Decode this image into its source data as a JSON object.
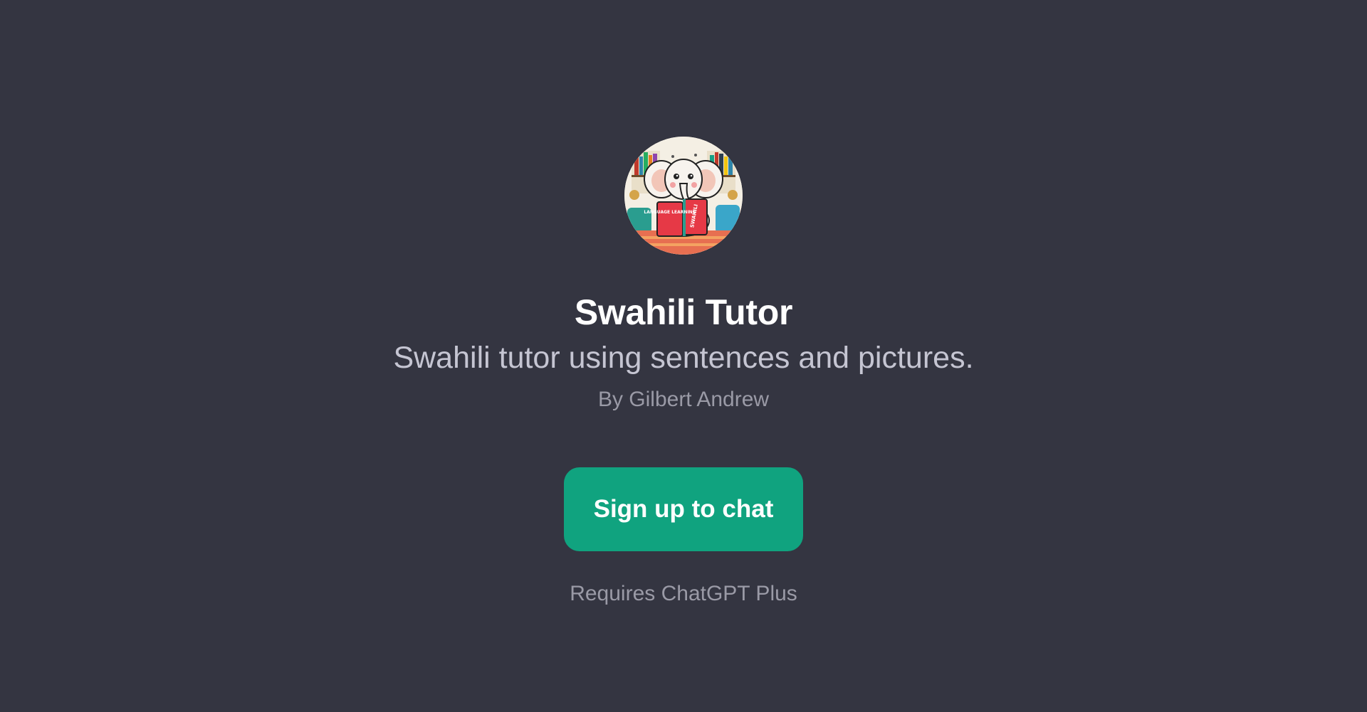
{
  "gpt": {
    "avatar_icon": "elephant-reading-book-avatar",
    "avatar_book_text_left": "LANGUAGE LEARNING",
    "avatar_book_text_right": "SWAHILI",
    "name": "Swahili Tutor",
    "description": "Swahili tutor using sentences and pictures.",
    "author": "By Gilbert Andrew"
  },
  "actions": {
    "signup_label": "Sign up to chat",
    "requirement_note": "Requires ChatGPT Plus"
  },
  "colors": {
    "background": "#343541",
    "accent": "#10a37f",
    "title": "#ffffff",
    "subtitle": "#c5c5d2",
    "muted": "#9a9aa6"
  }
}
